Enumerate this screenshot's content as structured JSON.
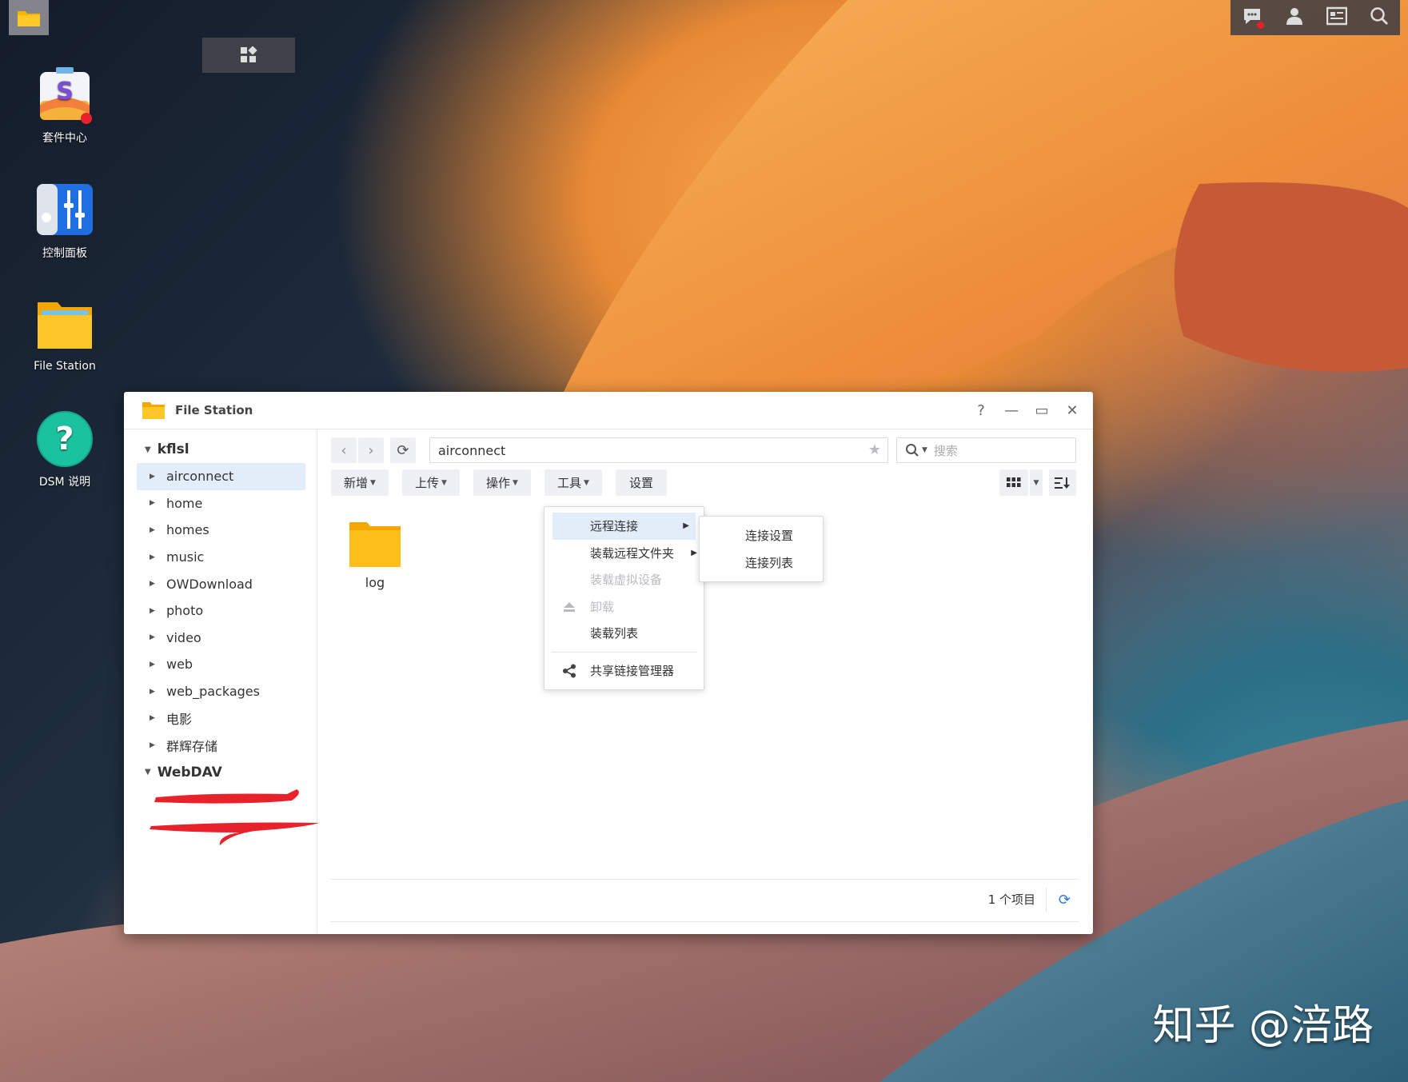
{
  "desktop": {
    "icons": [
      {
        "label": "套件中心"
      },
      {
        "label": "控制面板"
      },
      {
        "label": "File Station"
      },
      {
        "label": "DSM 说明"
      }
    ]
  },
  "window": {
    "title": "File Station",
    "controls": {
      "help": "?",
      "minimize": "—",
      "maximize": "▭",
      "close": "✕"
    }
  },
  "sidebar": {
    "roots": [
      {
        "label": "kflsl"
      },
      {
        "label": "WebDAV"
      }
    ],
    "items": [
      {
        "label": "airconnect"
      },
      {
        "label": "home"
      },
      {
        "label": "homes"
      },
      {
        "label": "music"
      },
      {
        "label": "OWDownload"
      },
      {
        "label": "photo"
      },
      {
        "label": "video"
      },
      {
        "label": "web"
      },
      {
        "label": "web_packages"
      },
      {
        "label": "电影"
      },
      {
        "label": "群辉存储"
      }
    ]
  },
  "toolbar": {
    "path": "airconnect",
    "search_placeholder": "搜索",
    "buttons": {
      "new": "新增",
      "upload": "上传",
      "action": "操作",
      "tools": "工具",
      "settings": "设置"
    }
  },
  "files": [
    {
      "name": "log"
    }
  ],
  "status": {
    "count_text": "1 个项目"
  },
  "tools_menu": {
    "items": [
      {
        "label": "远程连接"
      },
      {
        "label": "装载远程文件夹"
      },
      {
        "label": "装载虚拟设备"
      },
      {
        "label": "卸载"
      },
      {
        "label": "装载列表"
      },
      {
        "label": "共享链接管理器"
      }
    ]
  },
  "remote_submenu": {
    "items": [
      {
        "label": "连接设置"
      },
      {
        "label": "连接列表"
      }
    ]
  },
  "watermark": "知乎 @涪路",
  "colors": {
    "accent": "#2a7ad8",
    "selection": "#e3edfa",
    "folder": "#f7b500",
    "redact": "#e8222a"
  }
}
